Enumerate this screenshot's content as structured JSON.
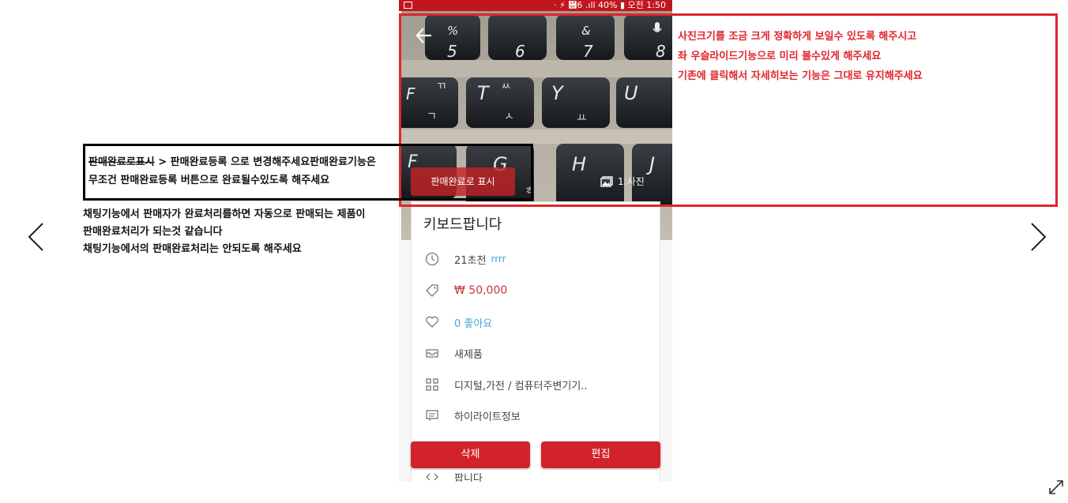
{
  "status_bar": {
    "text": "· ⚡ ὏6 .ıll 40% ▮ 오전 1:50"
  },
  "photo": {
    "sold_button_label": "판매완료로 표시",
    "photo_count_label": "1:사진"
  },
  "product": {
    "title": "키보드팝니다",
    "time": "21초전",
    "user": "rrrr",
    "price": "₩ 50,000",
    "likes": "0 좋아요",
    "condition": "새제품",
    "category": "디지털,가전 / 컴퓨터주변기기..",
    "highlight": "하이라이트정보",
    "partial_row": "",
    "description": "팝니다"
  },
  "buttons": {
    "delete": "삭제",
    "edit": "편집"
  },
  "notes": {
    "left_box_strike": "판매완료로표시",
    "left_box_line1_rest": " > 판매완료등록 으로 변경해주세요판매완료기능은",
    "left_box_line2": "무조건 판매완료등록 버튼으로 완료될수있도록 해주세요",
    "left_line1": "채팅기능에서 판매자가 완료처리를하면 자동으로 판매되는 제품이",
    "left_line2": "판매완료처리가 되는것 같습니다",
    "left_line3": "채팅기능에서의 판매완료처리는 안되도록 해주세요",
    "right_line1": " 사진크기를 조금 크게 정확하게 보일수 있도록 해주시고",
    "right_line2": " 좌 우슬라이드기능으로 미리 볼수있게 해주세요",
    "right_line3": "기존에 클릭해서 자세히보는 기능은 그대로 유지해주세요"
  },
  "colors": {
    "accent_red": "#d2232a",
    "annotation_red": "#e0252c",
    "link_blue": "#4aa3d6"
  },
  "icons": [
    "chevron-left-icon",
    "chevron-right-icon",
    "expand-icon",
    "back-arrow-icon",
    "microphone-icon",
    "gallery-icon",
    "clock-icon",
    "tag-icon",
    "heart-icon",
    "inbox-icon",
    "grid-icon",
    "message-icon",
    "code-icon"
  ]
}
